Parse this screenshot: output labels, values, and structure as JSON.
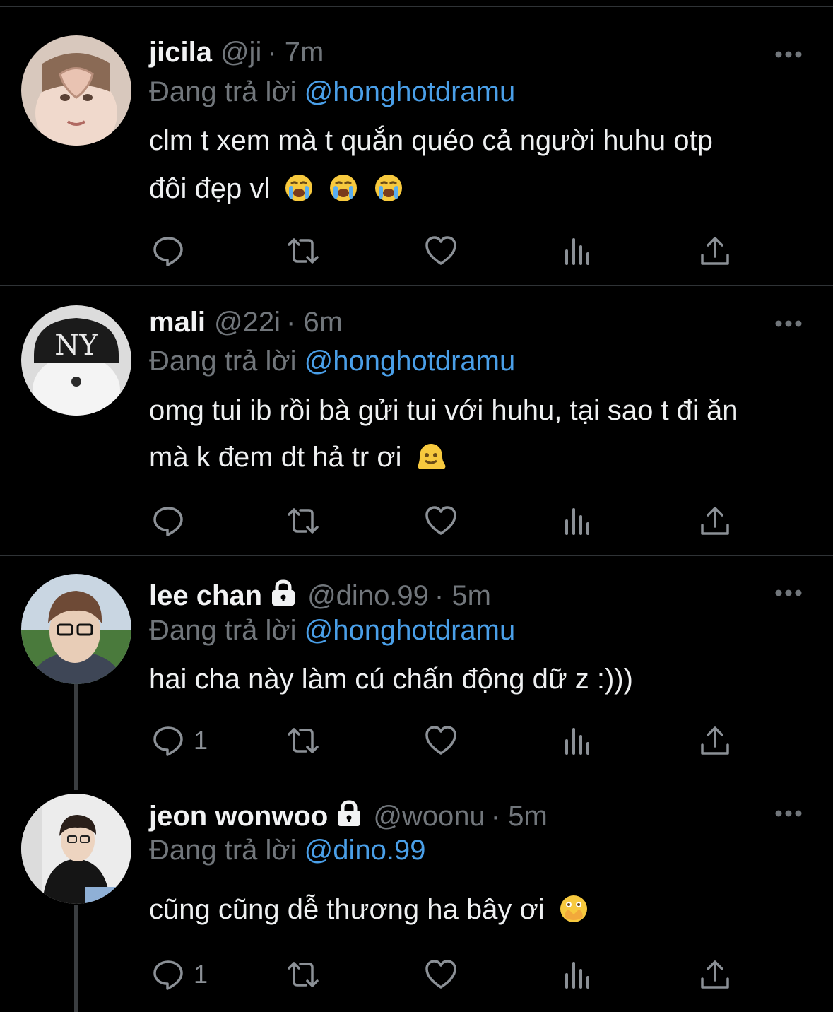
{
  "reply_prefix": "Đang trả lời",
  "tweets": [
    {
      "name": "jicila",
      "handle": "@ji",
      "time": "· 7m",
      "replying_to": "@honghotdramu",
      "text_lines": [
        "clm t xem mà t quắn quéo cả người huhu otp",
        "đôi đẹp vl"
      ],
      "emojis": [
        "loudly-crying-face",
        "loudly-crying-face",
        "loudly-crying-face"
      ],
      "locked": false,
      "reply_count": ""
    },
    {
      "name": "mali",
      "handle": "@22i",
      "time": "· 6m",
      "replying_to": "@honghotdramu",
      "text_lines": [
        "omg tui ib rồi bà gửi tui với huhu, tại sao t đi ăn",
        "mà k đem dt hả tr ơi"
      ],
      "emojis": [
        "melting-face"
      ],
      "locked": false,
      "reply_count": ""
    },
    {
      "name": "lee chan",
      "handle": "@dino.99",
      "time": "· 5m",
      "replying_to": "@honghotdramu",
      "text_lines": [
        "hai cha này làm cú chấn động dữ z :)))"
      ],
      "emojis": [],
      "locked": true,
      "reply_count": "1"
    },
    {
      "name": "jeon wonwoo",
      "handle": "@woonu",
      "time": "· 5m",
      "replying_to": "@dino.99",
      "text_lines": [
        "cũng cũng dễ thương ha bây ơi"
      ],
      "emojis": [
        "face-with-open-eyes-and-hand-over-mouth"
      ],
      "locked": true,
      "reply_count": "1"
    }
  ],
  "icons": {
    "reply": "reply-icon",
    "retweet": "retweet-icon",
    "like": "heart-icon",
    "views": "views-icon",
    "share": "share-icon",
    "more": "more-icon",
    "lock": "lock-icon"
  },
  "colors": {
    "background": "#000000",
    "text": "#e7e9ea",
    "muted": "#71767b",
    "link": "#4a9fe8",
    "separator": "#2f3336"
  }
}
